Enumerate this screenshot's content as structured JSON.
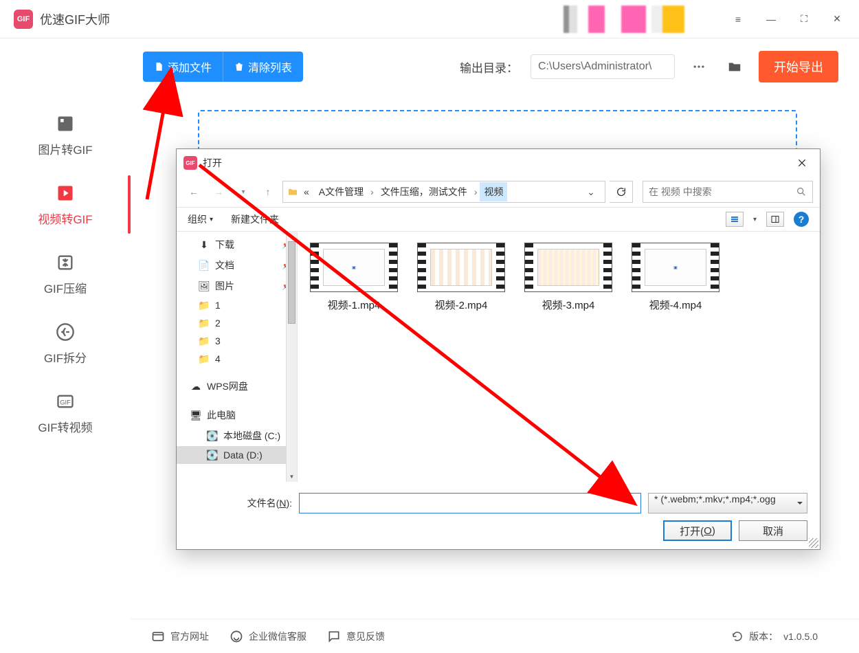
{
  "app": {
    "title": "优速GIF大师",
    "logo_text": "GIF"
  },
  "syscontrols": {
    "menu": "≡",
    "minimize": "—",
    "maximize": "⛶",
    "close": "✕"
  },
  "sidebar": {
    "items": [
      {
        "label": "图片转GIF",
        "icon": "image-icon"
      },
      {
        "label": "视频转GIF",
        "icon": "video-icon"
      },
      {
        "label": "GIF压缩",
        "icon": "compress-icon"
      },
      {
        "label": "GIF拆分",
        "icon": "split-icon"
      },
      {
        "label": "GIF转视频",
        "icon": "gif-icon"
      }
    ],
    "active_index": 1
  },
  "toolbar": {
    "add_label": "添加文件",
    "clear_label": "清除列表",
    "output_label": "输出目录：",
    "output_path": "C:\\Users\\Administrator\\",
    "start_label": "开始导出"
  },
  "footer": {
    "site": "官方网址",
    "wechat": "企业微信客服",
    "feedback": "意见反馈",
    "version_label": "版本：",
    "version": "v1.0.5.0"
  },
  "dialog": {
    "title": "打开",
    "breadcrumb": {
      "prefix": "«",
      "parts": [
        "A文件管理",
        "文件压缩，测试文件",
        "视频"
      ],
      "selected_index": 2
    },
    "search_placeholder": "在 视频 中搜索",
    "toolbar": {
      "organize": "组织",
      "newfolder": "新建文件夹"
    },
    "tree": [
      {
        "label": "下载",
        "icon": "download",
        "pinned": true
      },
      {
        "label": "文档",
        "icon": "doc",
        "pinned": true
      },
      {
        "label": "图片",
        "icon": "pic",
        "pinned": true
      },
      {
        "label": "1",
        "icon": "folder"
      },
      {
        "label": "2",
        "icon": "folder"
      },
      {
        "label": "3",
        "icon": "folder"
      },
      {
        "label": "4",
        "icon": "folder"
      },
      {
        "label": "WPS网盘",
        "icon": "cloud",
        "spaced": true
      },
      {
        "label": "此电脑",
        "icon": "pc",
        "spaced": true
      },
      {
        "label": "本地磁盘 (C:)",
        "icon": "disk",
        "level": 2
      },
      {
        "label": "Data (D:)",
        "icon": "disk",
        "level": 2,
        "selected": true
      }
    ],
    "files": [
      {
        "name": "视频-1.mp4",
        "style": "a"
      },
      {
        "name": "视频-2.mp4",
        "style": "b"
      },
      {
        "name": "视频-3.mp4",
        "style": "c"
      },
      {
        "name": "视频-4.mp4",
        "style": "a"
      }
    ],
    "filename_label_pre": "文件名(",
    "filename_label_key": "N",
    "filename_label_post": "):",
    "filetype": "* (*.webm;*.mkv;*.mp4;*.ogg",
    "open_btn_pre": "打开(",
    "open_btn_key": "O",
    "open_btn_post": ")",
    "cancel_btn": "取消"
  }
}
